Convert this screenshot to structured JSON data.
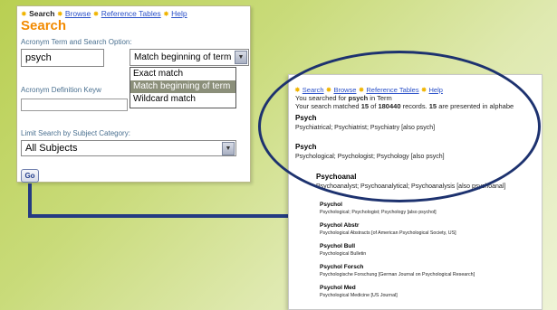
{
  "search": {
    "nav": {
      "current": "Search",
      "links": [
        "Browse",
        "Reference Tables",
        "Help"
      ]
    },
    "title": "Search",
    "term_label": "Acronym Term and Search Option:",
    "term_value": "psych",
    "option_selected": "Match beginning of term",
    "options": [
      "Exact match",
      "Match beginning of term",
      "Wildcard match"
    ],
    "definition_label": "Acronym Definition Keyw",
    "subject_label": "Limit Search by Subject Category:",
    "subject_value": "All Subjects",
    "go_label": "Go"
  },
  "results": {
    "nav": {
      "current": "Search",
      "links": [
        "Browse",
        "Reference Tables",
        "Help"
      ]
    },
    "summary_1": {
      "pre": "You searched for ",
      "term": "psych",
      "post": " in Term"
    },
    "summary_2": {
      "pre": "Your search matched ",
      "matched": "15",
      "mid": " of ",
      "total": "180440",
      "post": " records. ",
      "presented": "15",
      "tail": " are presented in alphabe"
    },
    "items": [
      {
        "term": "Psych",
        "definition": "Psychiatrical; Psychiatrist; Psychiatry [also psych]"
      },
      {
        "term": "Psych",
        "definition": "Psychological; Psychologist; Psychology [also psych]"
      },
      {
        "term": "Psychoanal",
        "definition": "Psychoanalyst; Psychoanalytical; Psychoanalysis [also psychoanal]"
      },
      {
        "term": "Psychol",
        "definition": "Psychological; Psychologist; Psychology [also psychol]"
      },
      {
        "term": "Psychol Abstr",
        "definition": "Psychological Abstracts [of American Psychological Society, US]"
      },
      {
        "term": "Psychol Bull",
        "definition": "Psychological Bulletin"
      },
      {
        "term": "Psychol Forsch",
        "definition": "Psychologische Forschung [German Journal on Psychological Research]"
      },
      {
        "term": "Psychol Med",
        "definition": "Psychological Medicine [US Journal]"
      }
    ]
  },
  "colors": {
    "accent": "#f28a00",
    "link": "#2a50c8",
    "connector": "#243b82",
    "highlight": "#8b8f7a"
  },
  "icons": {
    "nav_separator": "star-icon",
    "dropdown": "chevron-down-icon"
  }
}
